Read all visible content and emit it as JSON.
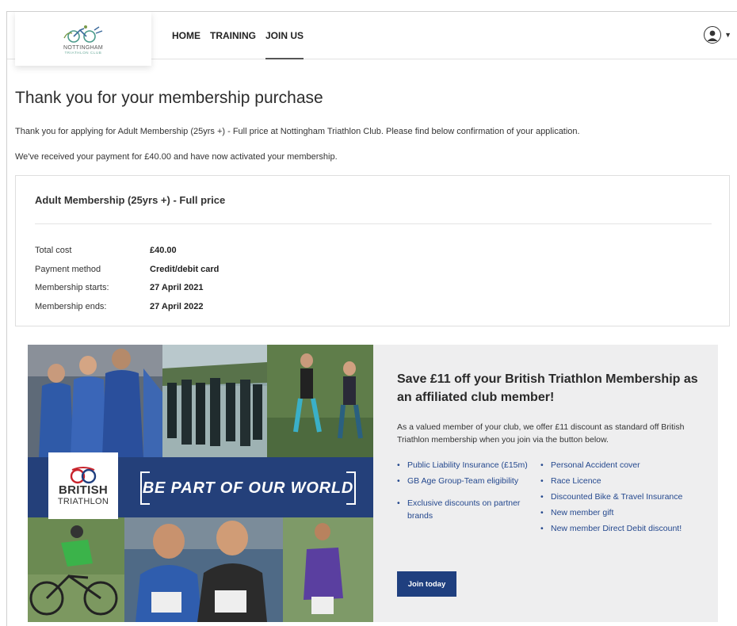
{
  "header": {
    "logo": {
      "name": "NOTTINGHAM",
      "sub": "TRIATHLON CLUB"
    },
    "nav": [
      {
        "label": "HOME"
      },
      {
        "label": "TRAINING"
      },
      {
        "label": "JOIN US",
        "active": true
      }
    ],
    "user_icon": "user-circle-icon",
    "dropdown_icon": "chevron-down-icon"
  },
  "page": {
    "title": "Thank you for your membership purchase",
    "intro": "Thank you for applying for Adult Membership (25yrs +) - Full price at Nottingham Triathlon Club. Please find below confirmation of your application.",
    "payment_note": "We've received your payment for £40.00 and have now activated your membership."
  },
  "summary": {
    "title": "Adult Membership (25yrs +) - Full price",
    "rows": [
      {
        "label": "Total cost",
        "value": "£40.00"
      },
      {
        "label": "Payment method",
        "value": "Credit/debit card"
      },
      {
        "label": "Membership starts:",
        "value": "27 April 2021"
      },
      {
        "label": "Membership ends:",
        "value": "27 April 2022"
      }
    ]
  },
  "promo": {
    "banner": {
      "brand_line1": "BRITISH",
      "brand_line2": "TRIATHLON",
      "slogan": "BE PART OF OUR WORLD"
    },
    "heading": "Save £11 off your British Triathlon Membership as an affiliated club member!",
    "body": "As a valued member of your club, we offer £11 discount as standard off British Triathlon membership when you join via the button below.",
    "benefits_left": [
      "Public Liability Insurance (£15m)",
      "GB Age Group-Team eligibility",
      "Exclusive discounts on partner brands"
    ],
    "benefits_right": [
      "Personal Accident cover",
      "Race Licence",
      "Discounted Bike & Travel Insurance",
      "New member gift",
      "New member Direct Debit discount!"
    ],
    "button": "Join today"
  },
  "colors": {
    "brand_blue": "#1f3f7f",
    "link_blue": "#24488e",
    "panel_bg": "#eeeeef"
  }
}
